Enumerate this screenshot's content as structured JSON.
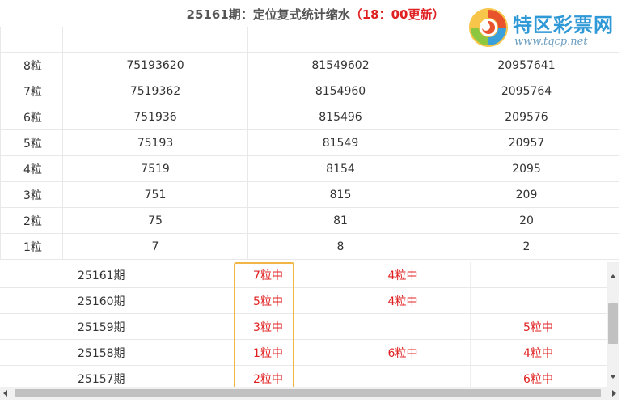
{
  "header": {
    "title_main": "25161期：定位复式统计缩水",
    "title_time": "（18：00更新）"
  },
  "logo": {
    "name": "特区彩票网",
    "url": "www.tqcp.net"
  },
  "stats_table": {
    "rows": [
      {
        "label": "",
        "c1": "",
        "c2": "",
        "c3": ""
      },
      {
        "label": "8粒",
        "c1": "75193620",
        "c2": "81549602",
        "c3": "20957641"
      },
      {
        "label": "7粒",
        "c1": "7519362",
        "c2": "8154960",
        "c3": "2095764"
      },
      {
        "label": "6粒",
        "c1": "751936",
        "c2": "815496",
        "c3": "209576"
      },
      {
        "label": "5粒",
        "c1": "75193",
        "c2": "81549",
        "c3": "20957"
      },
      {
        "label": "4粒",
        "c1": "7519",
        "c2": "8154",
        "c3": "2095"
      },
      {
        "label": "3粒",
        "c1": "751",
        "c2": "815",
        "c3": "209"
      },
      {
        "label": "2粒",
        "c1": "75",
        "c2": "81",
        "c3": "20"
      },
      {
        "label": "1粒",
        "c1": "7",
        "c2": "8",
        "c3": "2"
      }
    ]
  },
  "history_table": {
    "rows": [
      {
        "issue": "25161期",
        "c1": "7粒中",
        "c2": "4粒中",
        "c3": ""
      },
      {
        "issue": "25160期",
        "c1": "5粒中",
        "c2": "4粒中",
        "c3": ""
      },
      {
        "issue": "25159期",
        "c1": "3粒中",
        "c2": "",
        "c3": "5粒中"
      },
      {
        "issue": "25158期",
        "c1": "1粒中",
        "c2": "6粒中",
        "c3": "4粒中"
      },
      {
        "issue": "25157期",
        "c1": "2粒中",
        "c2": "",
        "c3": "6粒中"
      }
    ]
  },
  "colors": {
    "hit": "#e02020",
    "highlight_border": "#f1b646",
    "logo_blue": "#2f98d6"
  }
}
